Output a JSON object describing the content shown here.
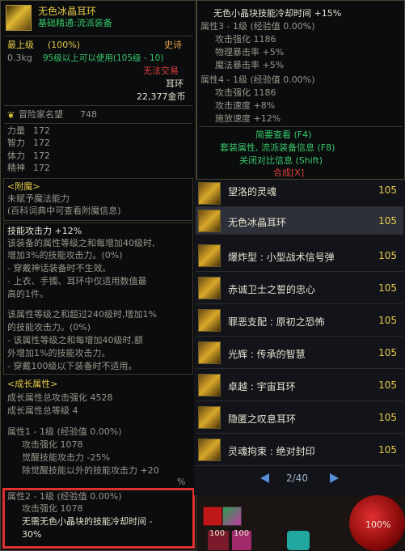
{
  "left_tooltip": {
    "item_name": "无色冰晶耳环",
    "item_subtitle": "基础精通:流派装备",
    "grade": "最上级",
    "grade_pct": "(100%)",
    "rarity": "史诗",
    "weight": "0.3kg",
    "level_req": "95级以上可以使用(105级 - 10)",
    "trade": "无法交易",
    "slot": "耳环",
    "price": "22,377金币",
    "renown_label": "冒险家名望",
    "renown_value": "748",
    "stats": [
      {
        "label": "力量",
        "value": "172"
      },
      {
        "label": "智力",
        "value": "172"
      },
      {
        "label": "体力",
        "value": "172"
      },
      {
        "label": "精神",
        "value": "172"
      }
    ],
    "enchant_header": "<附魔>",
    "enchant_text": "未赋予魔法能力",
    "enchant_hint": "(百科词典中可查看附魔信息)",
    "skill_atk_title": "技能攻击力 +12%",
    "skill_atk_lines": [
      "该装备的属性等级之和每增加40级时,",
      "增加3%的技能攻击力。(0%)",
      "- 穿戴神话装备时不生效。",
      "- 上衣、手镯、耳环中仅适用数值最",
      "高的1件。",
      "",
      "该属性等级之和超过240级时,增加1%",
      "的技能攻击力。(0%)",
      "- 该属性等级之和每增加40级时,额",
      "外增加1%的技能攻击力。",
      "- 穿戴100级以下装备时不适用。"
    ],
    "growth_header": "<成长属性>",
    "growth_total_atk": "成长属性总攻击强化 4528",
    "growth_total_lvl": "成长属性总等级 4",
    "attr1_title": "属性1 - 1级 (经验值 0.00%)",
    "attr1_lines": [
      "攻击强化 1078",
      "觉醒技能攻击力 -25%",
      "除觉醒技能以外的技能攻击力 +20",
      "%"
    ],
    "attr2_title": "属性2 - 1级 (经验值 0.00%)",
    "attr2_lines": [
      "攻击强化 1078",
      "无需无色小晶块的技能冷却时间 -",
      "30%"
    ]
  },
  "right_tooltip": {
    "line1": "无色小晶块技能冷却时间 +15%",
    "attr3_title": "属性3 - 1级 (经验值 0.00%)",
    "attr3_lines": [
      "攻击强化 1186",
      "物理暴击率 +5%",
      "魔法暴击率 +5%"
    ],
    "attr4_title": "属性4 - 1级 (经验值 0.00%)",
    "attr4_lines": [
      "攻击强化 1186",
      "攻击速度 +8%",
      "施放速度 +12%"
    ],
    "link_simple": "简要查看 (F4)",
    "link_set": "套装属性, 流派装备信息 (F8)",
    "link_compare": "关闭对比信息 (Shift)",
    "link_synth": "合成[X]"
  },
  "item_list": {
    "rows": [
      {
        "name": "望洛的灵魂",
        "level": "105",
        "icon": "ring-icon",
        "selected": false
      },
      {
        "name": "无色冰晶耳环",
        "level": "105",
        "icon": "earring-icon",
        "selected": true
      },
      {
        "name": "爆炸型 : 小型战术信号弹",
        "level": "105",
        "icon": "flare-icon",
        "selected": false
      },
      {
        "name": "赤诚卫士之誓的忠心",
        "level": "105",
        "icon": "emblem-icon",
        "selected": false
      },
      {
        "name": "罪恶支配 : 原初之恐怖",
        "level": "105",
        "icon": "skull-icon",
        "selected": false
      },
      {
        "name": "光辉 : 传承的智慧",
        "level": "105",
        "icon": "light-icon",
        "selected": false
      },
      {
        "name": "卓越 : 宇宙耳环",
        "level": "105",
        "icon": "cosmic-icon",
        "selected": false
      },
      {
        "name": "隐匿之叹息耳环",
        "level": "105",
        "icon": "sigh-icon",
        "selected": false
      },
      {
        "name": "灵魂拘束 : 绝对封印",
        "level": "105",
        "icon": "bind-icon",
        "selected": false
      }
    ],
    "pager": "2/40"
  },
  "bottom": {
    "orb_pct": "100%",
    "slot_a": "100",
    "slot_b": "100"
  }
}
